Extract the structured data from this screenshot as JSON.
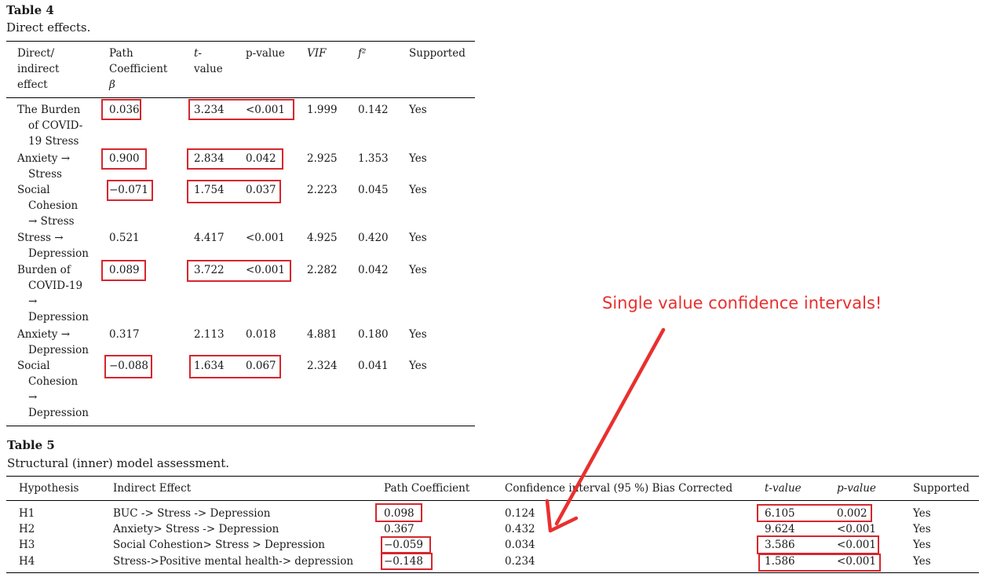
{
  "table4": {
    "title": "Table 4",
    "caption": "Direct effects.",
    "headers": {
      "effect": [
        "Direct/",
        "indirect",
        "effect"
      ],
      "path": [
        "Path",
        "Coefficient",
        "β"
      ],
      "t": [
        "t-",
        "value"
      ],
      "p": "p-value",
      "vif": "VIF",
      "f2": "f²",
      "supported": "Supported"
    },
    "rows": [
      {
        "effect": [
          "The Burden",
          "of COVID-",
          "19 Stress"
        ],
        "path": "0.036",
        "t": "3.234",
        "p": "<0.001",
        "vif": "1.999",
        "f2": "0.142",
        "supported": "Yes"
      },
      {
        "effect": [
          "Anxiety →",
          "Stress"
        ],
        "path": "0.900",
        "t": "2.834",
        "p": "0.042",
        "vif": "2.925",
        "f2": "1.353",
        "supported": "Yes"
      },
      {
        "effect": [
          "Social",
          "Cohesion",
          "→ Stress"
        ],
        "path": "−0.071",
        "t": "1.754",
        "p": "0.037",
        "vif": "2.223",
        "f2": "0.045",
        "supported": "Yes"
      },
      {
        "effect": [
          "Stress →",
          "Depression"
        ],
        "path": "0.521",
        "t": "4.417",
        "p": "<0.001",
        "vif": "4.925",
        "f2": "0.420",
        "supported": "Yes"
      },
      {
        "effect": [
          "Burden of",
          "COVID-19",
          "→",
          "Depression"
        ],
        "path": "0.089",
        "t": "3.722",
        "p": "<0.001",
        "vif": "2.282",
        "f2": "0.042",
        "supported": "Yes"
      },
      {
        "effect": [
          "Anxiety →",
          "Depression"
        ],
        "path": "0.317",
        "t": "2.113",
        "p": "0.018",
        "vif": "4.881",
        "f2": "0.180",
        "supported": "Yes"
      },
      {
        "effect": [
          "Social",
          "Cohesion",
          "→",
          "Depression"
        ],
        "path": "−0.088",
        "t": "1.634",
        "p": "0.067",
        "vif": "2.324",
        "f2": "0.041",
        "supported": "Yes"
      }
    ]
  },
  "table5": {
    "title": "Table 5",
    "caption": "Structural (inner) model assessment.",
    "headers": {
      "hypothesis": "Hypothesis",
      "indirect": "Indirect Effect",
      "path": "Path Coefficient",
      "ci": "Confidence interval (95 %) Bias Corrected",
      "t": "t-value",
      "p": "p-value",
      "supported": "Supported"
    },
    "rows": [
      {
        "hypothesis": "H1",
        "indirect": "BUC -> Stress -> Depression",
        "path": "0.098",
        "ci": "0.124",
        "t": "6.105",
        "p": "0.002",
        "supported": "Yes"
      },
      {
        "hypothesis": "H2",
        "indirect": "Anxiety> Stress -> Depression",
        "path": "0.367",
        "ci": "0.432",
        "t": "9.624",
        "p": "<0.001",
        "supported": "Yes"
      },
      {
        "hypothesis": "H3",
        "indirect": "Social Cohestion> Stress > Depression",
        "path": "−0.059",
        "ci": "0.034",
        "t": "3.586",
        "p": "<0.001",
        "supported": "Yes"
      },
      {
        "hypothesis": "H4",
        "indirect": "Stress->Positive mental health-> depression",
        "path": "−0.148",
        "ci": "0.234",
        "t": "1.586",
        "p": "<0.001",
        "supported": "Yes"
      }
    ]
  },
  "annotation": {
    "text": "Single value confidence intervals!",
    "color": "#e8302f"
  }
}
